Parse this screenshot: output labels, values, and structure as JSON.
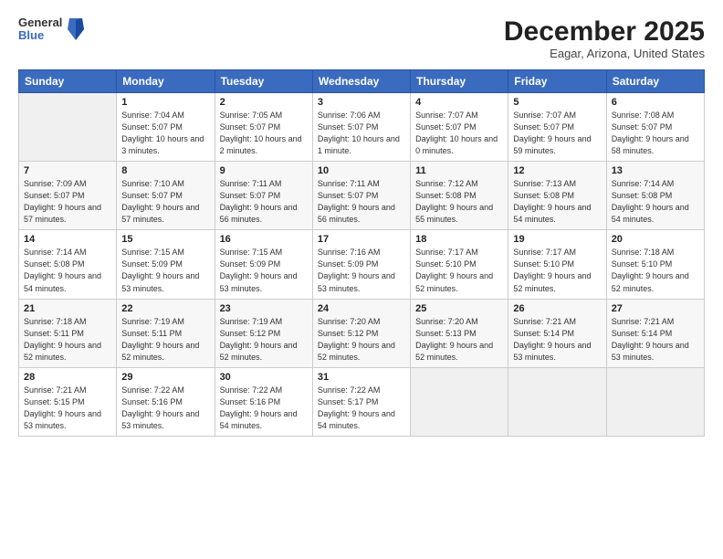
{
  "logo": {
    "general": "General",
    "blue": "Blue"
  },
  "header": {
    "month": "December 2025",
    "location": "Eagar, Arizona, United States"
  },
  "weekdays": [
    "Sunday",
    "Monday",
    "Tuesday",
    "Wednesday",
    "Thursday",
    "Friday",
    "Saturday"
  ],
  "weeks": [
    [
      {
        "day": "",
        "sunrise": "",
        "sunset": "",
        "daylight": ""
      },
      {
        "day": "1",
        "sunrise": "Sunrise: 7:04 AM",
        "sunset": "Sunset: 5:07 PM",
        "daylight": "Daylight: 10 hours and 3 minutes."
      },
      {
        "day": "2",
        "sunrise": "Sunrise: 7:05 AM",
        "sunset": "Sunset: 5:07 PM",
        "daylight": "Daylight: 10 hours and 2 minutes."
      },
      {
        "day": "3",
        "sunrise": "Sunrise: 7:06 AM",
        "sunset": "Sunset: 5:07 PM",
        "daylight": "Daylight: 10 hours and 1 minute."
      },
      {
        "day": "4",
        "sunrise": "Sunrise: 7:07 AM",
        "sunset": "Sunset: 5:07 PM",
        "daylight": "Daylight: 10 hours and 0 minutes."
      },
      {
        "day": "5",
        "sunrise": "Sunrise: 7:07 AM",
        "sunset": "Sunset: 5:07 PM",
        "daylight": "Daylight: 9 hours and 59 minutes."
      },
      {
        "day": "6",
        "sunrise": "Sunrise: 7:08 AM",
        "sunset": "Sunset: 5:07 PM",
        "daylight": "Daylight: 9 hours and 58 minutes."
      }
    ],
    [
      {
        "day": "7",
        "sunrise": "Sunrise: 7:09 AM",
        "sunset": "Sunset: 5:07 PM",
        "daylight": "Daylight: 9 hours and 57 minutes."
      },
      {
        "day": "8",
        "sunrise": "Sunrise: 7:10 AM",
        "sunset": "Sunset: 5:07 PM",
        "daylight": "Daylight: 9 hours and 57 minutes."
      },
      {
        "day": "9",
        "sunrise": "Sunrise: 7:11 AM",
        "sunset": "Sunset: 5:07 PM",
        "daylight": "Daylight: 9 hours and 56 minutes."
      },
      {
        "day": "10",
        "sunrise": "Sunrise: 7:11 AM",
        "sunset": "Sunset: 5:07 PM",
        "daylight": "Daylight: 9 hours and 56 minutes."
      },
      {
        "day": "11",
        "sunrise": "Sunrise: 7:12 AM",
        "sunset": "Sunset: 5:08 PM",
        "daylight": "Daylight: 9 hours and 55 minutes."
      },
      {
        "day": "12",
        "sunrise": "Sunrise: 7:13 AM",
        "sunset": "Sunset: 5:08 PM",
        "daylight": "Daylight: 9 hours and 54 minutes."
      },
      {
        "day": "13",
        "sunrise": "Sunrise: 7:14 AM",
        "sunset": "Sunset: 5:08 PM",
        "daylight": "Daylight: 9 hours and 54 minutes."
      }
    ],
    [
      {
        "day": "14",
        "sunrise": "Sunrise: 7:14 AM",
        "sunset": "Sunset: 5:08 PM",
        "daylight": "Daylight: 9 hours and 54 minutes."
      },
      {
        "day": "15",
        "sunrise": "Sunrise: 7:15 AM",
        "sunset": "Sunset: 5:09 PM",
        "daylight": "Daylight: 9 hours and 53 minutes."
      },
      {
        "day": "16",
        "sunrise": "Sunrise: 7:15 AM",
        "sunset": "Sunset: 5:09 PM",
        "daylight": "Daylight: 9 hours and 53 minutes."
      },
      {
        "day": "17",
        "sunrise": "Sunrise: 7:16 AM",
        "sunset": "Sunset: 5:09 PM",
        "daylight": "Daylight: 9 hours and 53 minutes."
      },
      {
        "day": "18",
        "sunrise": "Sunrise: 7:17 AM",
        "sunset": "Sunset: 5:10 PM",
        "daylight": "Daylight: 9 hours and 52 minutes."
      },
      {
        "day": "19",
        "sunrise": "Sunrise: 7:17 AM",
        "sunset": "Sunset: 5:10 PM",
        "daylight": "Daylight: 9 hours and 52 minutes."
      },
      {
        "day": "20",
        "sunrise": "Sunrise: 7:18 AM",
        "sunset": "Sunset: 5:10 PM",
        "daylight": "Daylight: 9 hours and 52 minutes."
      }
    ],
    [
      {
        "day": "21",
        "sunrise": "Sunrise: 7:18 AM",
        "sunset": "Sunset: 5:11 PM",
        "daylight": "Daylight: 9 hours and 52 minutes."
      },
      {
        "day": "22",
        "sunrise": "Sunrise: 7:19 AM",
        "sunset": "Sunset: 5:11 PM",
        "daylight": "Daylight: 9 hours and 52 minutes."
      },
      {
        "day": "23",
        "sunrise": "Sunrise: 7:19 AM",
        "sunset": "Sunset: 5:12 PM",
        "daylight": "Daylight: 9 hours and 52 minutes."
      },
      {
        "day": "24",
        "sunrise": "Sunrise: 7:20 AM",
        "sunset": "Sunset: 5:12 PM",
        "daylight": "Daylight: 9 hours and 52 minutes."
      },
      {
        "day": "25",
        "sunrise": "Sunrise: 7:20 AM",
        "sunset": "Sunset: 5:13 PM",
        "daylight": "Daylight: 9 hours and 52 minutes."
      },
      {
        "day": "26",
        "sunrise": "Sunrise: 7:21 AM",
        "sunset": "Sunset: 5:14 PM",
        "daylight": "Daylight: 9 hours and 53 minutes."
      },
      {
        "day": "27",
        "sunrise": "Sunrise: 7:21 AM",
        "sunset": "Sunset: 5:14 PM",
        "daylight": "Daylight: 9 hours and 53 minutes."
      }
    ],
    [
      {
        "day": "28",
        "sunrise": "Sunrise: 7:21 AM",
        "sunset": "Sunset: 5:15 PM",
        "daylight": "Daylight: 9 hours and 53 minutes."
      },
      {
        "day": "29",
        "sunrise": "Sunrise: 7:22 AM",
        "sunset": "Sunset: 5:16 PM",
        "daylight": "Daylight: 9 hours and 53 minutes."
      },
      {
        "day": "30",
        "sunrise": "Sunrise: 7:22 AM",
        "sunset": "Sunset: 5:16 PM",
        "daylight": "Daylight: 9 hours and 54 minutes."
      },
      {
        "day": "31",
        "sunrise": "Sunrise: 7:22 AM",
        "sunset": "Sunset: 5:17 PM",
        "daylight": "Daylight: 9 hours and 54 minutes."
      },
      {
        "day": "",
        "sunrise": "",
        "sunset": "",
        "daylight": ""
      },
      {
        "day": "",
        "sunrise": "",
        "sunset": "",
        "daylight": ""
      },
      {
        "day": "",
        "sunrise": "",
        "sunset": "",
        "daylight": ""
      }
    ]
  ]
}
